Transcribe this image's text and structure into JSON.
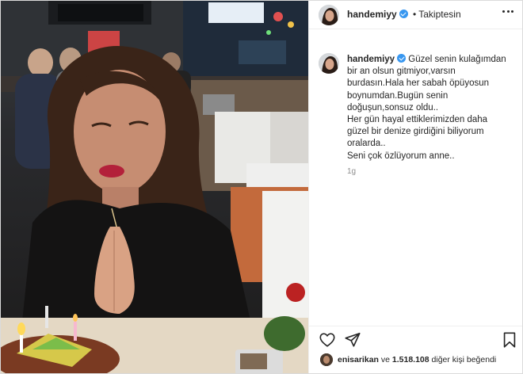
{
  "post": {
    "username": "handemiyy",
    "separator": "•",
    "follow_status": "Takiptesin",
    "caption_lines": [
      "Güzel senin kulağımdan",
      "bir an olsun gitmiyor,varsın",
      "burdasın.Hala her sabah öpüyosun",
      "boynumdan.Bugün senin",
      "doğuşun,sonsuz oldu..",
      "Her gün hayal ettiklerimizden daha",
      "güzel bir denize girdiğini biliyorum",
      "oralarda..",
      "Seni çok özlüyorum anne.."
    ],
    "time_ago": "1g"
  },
  "likes": {
    "first_user": "enisarikan",
    "and_word": "ve",
    "count": "1.518.108",
    "suffix": "diğer kişi beğendi"
  },
  "icons": {
    "heart": "heart-icon",
    "share": "share-icon",
    "bookmark": "bookmark-icon",
    "more": "more-options-icon",
    "verified": "verified-badge-icon"
  },
  "colors": {
    "verified": "#3897f0",
    "text": "#262626",
    "muted": "#8e8e8e",
    "border": "#dbdbdb"
  }
}
